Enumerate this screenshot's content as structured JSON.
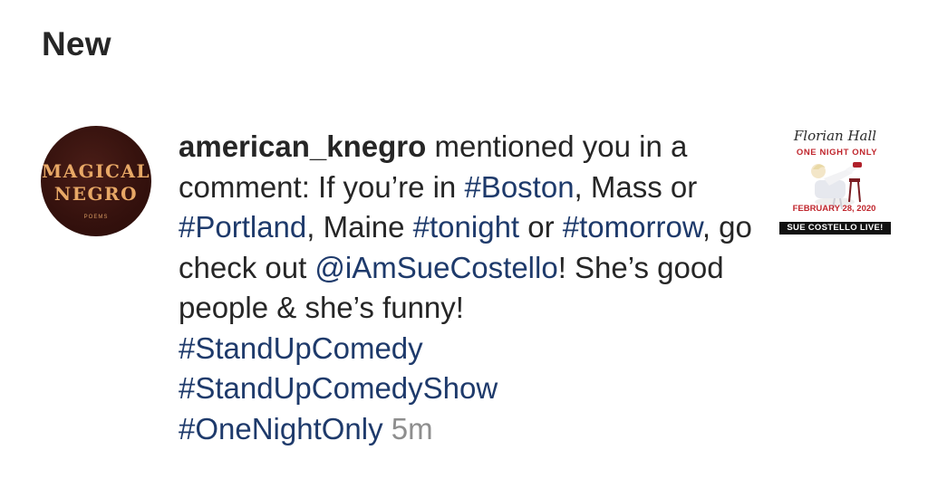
{
  "section": {
    "title": "New"
  },
  "notification": {
    "avatar": {
      "line1": "MAGICAL",
      "line2": "NEGRO",
      "sub": "POEMS",
      "bg_color": "#34110d",
      "text_color": "#e8a866"
    },
    "username": "american_knegro",
    "action": " mentioned you in a comment: If you’re in ",
    "hashtag_boston": "#Boston",
    "text_2": ", Mass or ",
    "hashtag_portland": "#Portland",
    "text_3": ", Maine ",
    "hashtag_tonight": "#tonight",
    "text_4": " or ",
    "hashtag_tomorrow": "#tomorrow",
    "text_5": ", go check out ",
    "mention": "@iAmSueCostello",
    "text_6": "! She’s good people & she’s funny!",
    "hashtag_standup": "#StandUpComedy",
    "hashtag_standup_show": "#StandUpComedyShow",
    "hashtag_one_night": "#OneNightOnly",
    "timestamp": "5m",
    "link_color": "#1e3a6b",
    "timestamp_color": "#8e8e8e"
  },
  "thumbnail": {
    "hall": "Florian Hall",
    "one_night": "ONE NIGHT ONLY",
    "date": "FEBRUARY 28, 2020",
    "banner": "SUE COSTELLO LIVE!",
    "accent_color": "#c0262d"
  }
}
